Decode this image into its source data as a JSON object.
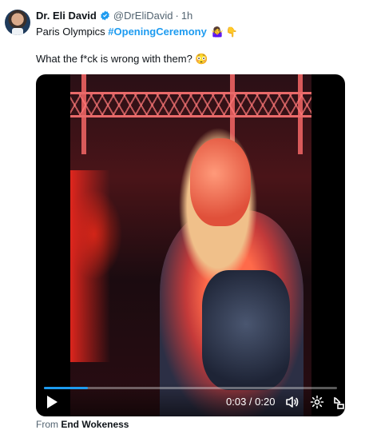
{
  "tweet": {
    "author_name": "Dr. Eli David",
    "handle": "@DrEliDavid",
    "separator": "·",
    "time": "1h",
    "text_line1_prefix": "Paris Olympics ",
    "hashtag": "#OpeningCeremony",
    "text_line2": "What the f*ck is wrong with them? 😳",
    "emojis": "🤷‍♀️ 👇"
  },
  "video": {
    "current_time": "0:03",
    "duration": "0:20",
    "timecode": "0:03 / 0:20",
    "progress_fraction": 0.15
  },
  "footer": {
    "from_label": "From",
    "source": "End Wokeness"
  },
  "colors": {
    "accent": "#1d9bf0",
    "text": "#0f1419",
    "muted": "#536471"
  }
}
